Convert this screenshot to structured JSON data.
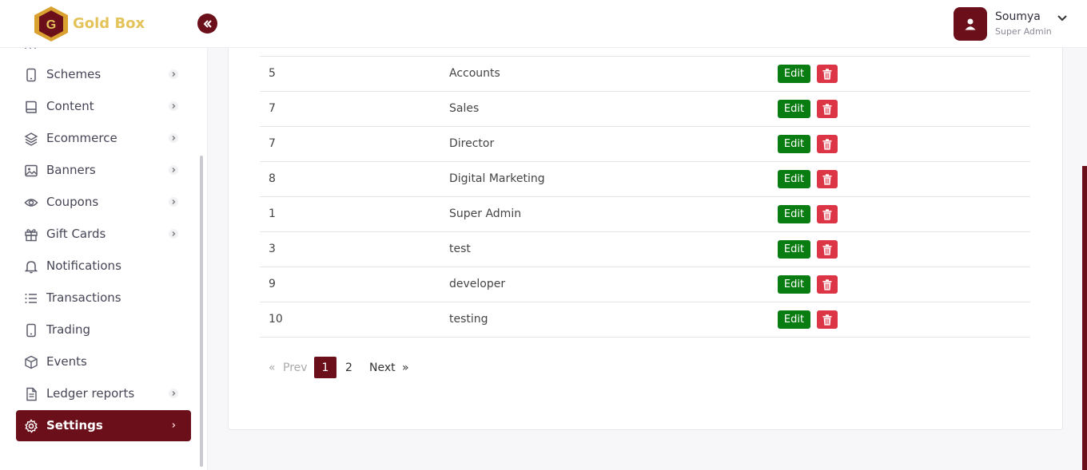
{
  "header": {
    "brand": "Gold Box",
    "user": {
      "name": "Soumya",
      "role": "Super Admin"
    }
  },
  "sidebar": {
    "items": [
      {
        "label": "Schemes",
        "icon": "phone-icon",
        "has_chevron": true,
        "active": false
      },
      {
        "label": "Content",
        "icon": "book-icon",
        "has_chevron": true,
        "active": false
      },
      {
        "label": "Ecommerce",
        "icon": "layers-icon",
        "has_chevron": true,
        "active": false
      },
      {
        "label": "Banners",
        "icon": "image-icon",
        "has_chevron": true,
        "active": false
      },
      {
        "label": "Coupons",
        "icon": "eye-icon",
        "has_chevron": true,
        "active": false
      },
      {
        "label": "Gift Cards",
        "icon": "gift-icon",
        "has_chevron": true,
        "active": false
      },
      {
        "label": "Notifications",
        "icon": "bell-icon",
        "has_chevron": false,
        "active": false
      },
      {
        "label": "Transactions",
        "icon": "list-icon",
        "has_chevron": false,
        "active": false
      },
      {
        "label": "Trading",
        "icon": "phone-icon",
        "has_chevron": false,
        "active": false
      },
      {
        "label": "Events",
        "icon": "box-icon",
        "has_chevron": false,
        "active": false
      },
      {
        "label": "Ledger reports",
        "icon": "file-icon",
        "has_chevron": true,
        "active": false
      },
      {
        "label": "Settings",
        "icon": "gear-icon",
        "has_chevron": true,
        "active": true
      }
    ]
  },
  "table": {
    "edit_label": "Edit",
    "rows": [
      {
        "id": "5",
        "name": "Accounts"
      },
      {
        "id": "7",
        "name": "Sales"
      },
      {
        "id": "7",
        "name": "Director"
      },
      {
        "id": "8",
        "name": "Digital Marketing"
      },
      {
        "id": "1",
        "name": "Super Admin"
      },
      {
        "id": "3",
        "name": "test"
      },
      {
        "id": "9",
        "name": "developer"
      },
      {
        "id": "10",
        "name": "testing"
      }
    ]
  },
  "pagination": {
    "prev_arrow": "«",
    "prev_label": "Prev",
    "pages": [
      "1",
      "2"
    ],
    "current": "1",
    "next_label": "Next",
    "next_arrow": "»"
  },
  "colors": {
    "accent": "#6b0f1a",
    "edit": "#0a7d12",
    "delete": "#dc3545",
    "brand_gold": "#e3c35a"
  }
}
